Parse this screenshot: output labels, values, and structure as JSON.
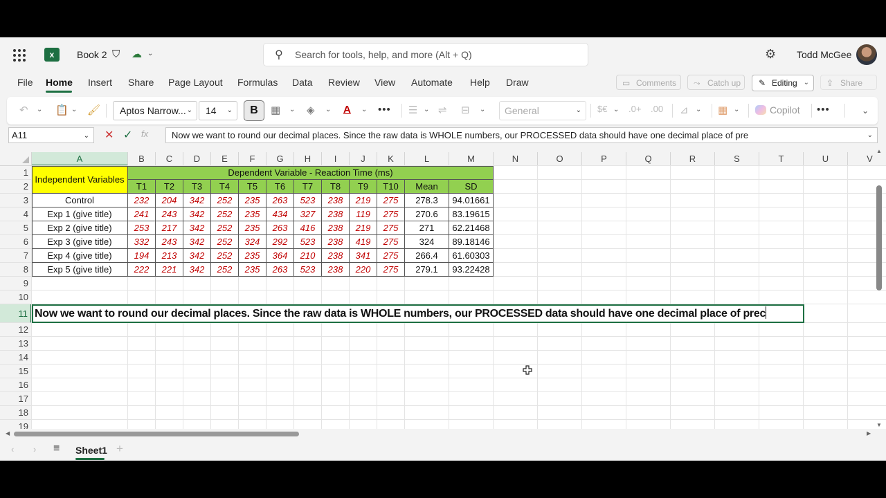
{
  "titlebar": {
    "book_name": "Book 2",
    "search_placeholder": "Search for tools, help, and more (Alt + Q)",
    "user_name": "Todd McGee"
  },
  "menu": {
    "tabs": [
      "File",
      "Home",
      "Insert",
      "Share",
      "Page Layout",
      "Formulas",
      "Data",
      "Review",
      "View",
      "Automate",
      "Help",
      "Draw"
    ],
    "active_tab": "Home",
    "comments_label": "Comments",
    "catchup_label": "Catch up",
    "editing_label": "Editing",
    "share_label": "Share"
  },
  "ribbon": {
    "font_name": "Aptos Narrow...",
    "font_size": "14",
    "bold_label": "B",
    "number_format": "General",
    "copilot_label": "Copilot"
  },
  "formula_bar": {
    "name_box": "A11",
    "formula": "Now we want to round our decimal places. Since the raw data is WHOLE numbers, our PROCESSED data should have one decimal place of pre"
  },
  "grid": {
    "columns": [
      "A",
      "B",
      "C",
      "D",
      "E",
      "F",
      "G",
      "H",
      "I",
      "J",
      "K",
      "L",
      "M",
      "N",
      "O",
      "P",
      "Q",
      "R",
      "S",
      "T",
      "U",
      "V"
    ],
    "rows": [
      "1",
      "2",
      "3",
      "4",
      "5",
      "6",
      "7",
      "8",
      "9",
      "10",
      "11",
      "12",
      "13",
      "14",
      "15",
      "16",
      "17",
      "18",
      "19"
    ],
    "selected_column": "A",
    "selected_row": "11"
  },
  "table": {
    "independent_header": "Independent Variables",
    "dependent_header": "Dependent Variable - Reaction Time (ms)",
    "trial_headers": [
      "T1",
      "T2",
      "T3",
      "T4",
      "T5",
      "T6",
      "T7",
      "T8",
      "T9",
      "T10"
    ],
    "mean_header": "Mean",
    "sd_header": "SD",
    "rows": [
      {
        "label": "Control",
        "values": [
          "232",
          "204",
          "342",
          "252",
          "235",
          "263",
          "523",
          "238",
          "219",
          "275"
        ],
        "mean": "278.3",
        "sd": "94.01661"
      },
      {
        "label": "Exp 1 (give title)",
        "values": [
          "241",
          "243",
          "342",
          "252",
          "235",
          "434",
          "327",
          "238",
          "119",
          "275"
        ],
        "mean": "270.6",
        "sd": "83.19615"
      },
      {
        "label": "Exp 2  (give title)",
        "values": [
          "253",
          "217",
          "342",
          "252",
          "235",
          "263",
          "416",
          "238",
          "219",
          "275"
        ],
        "mean": "271",
        "sd": "62.21468"
      },
      {
        "label": "Exp 3  (give title)",
        "values": [
          "332",
          "243",
          "342",
          "252",
          "324",
          "292",
          "523",
          "238",
          "419",
          "275"
        ],
        "mean": "324",
        "sd": "89.18146"
      },
      {
        "label": "Exp 4  (give title)",
        "values": [
          "194",
          "213",
          "342",
          "252",
          "235",
          "364",
          "210",
          "238",
          "341",
          "275"
        ],
        "mean": "266.4",
        "sd": "61.60303"
      },
      {
        "label": "Exp 5  (give title)",
        "values": [
          "222",
          "221",
          "342",
          "252",
          "235",
          "263",
          "523",
          "238",
          "220",
          "275"
        ],
        "mean": "279.1",
        "sd": "93.22428"
      }
    ]
  },
  "active_cell_text": "Now we want to round our decimal places. Since the raw data is WHOLE numbers, our PROCESSED data should have one decimal place of prec",
  "sheets": {
    "active": "Sheet1"
  },
  "colors": {
    "accent": "#1d6f42",
    "header_yellow": "#ffff00",
    "header_green": "#92d050",
    "raw_data": "#c00000"
  }
}
